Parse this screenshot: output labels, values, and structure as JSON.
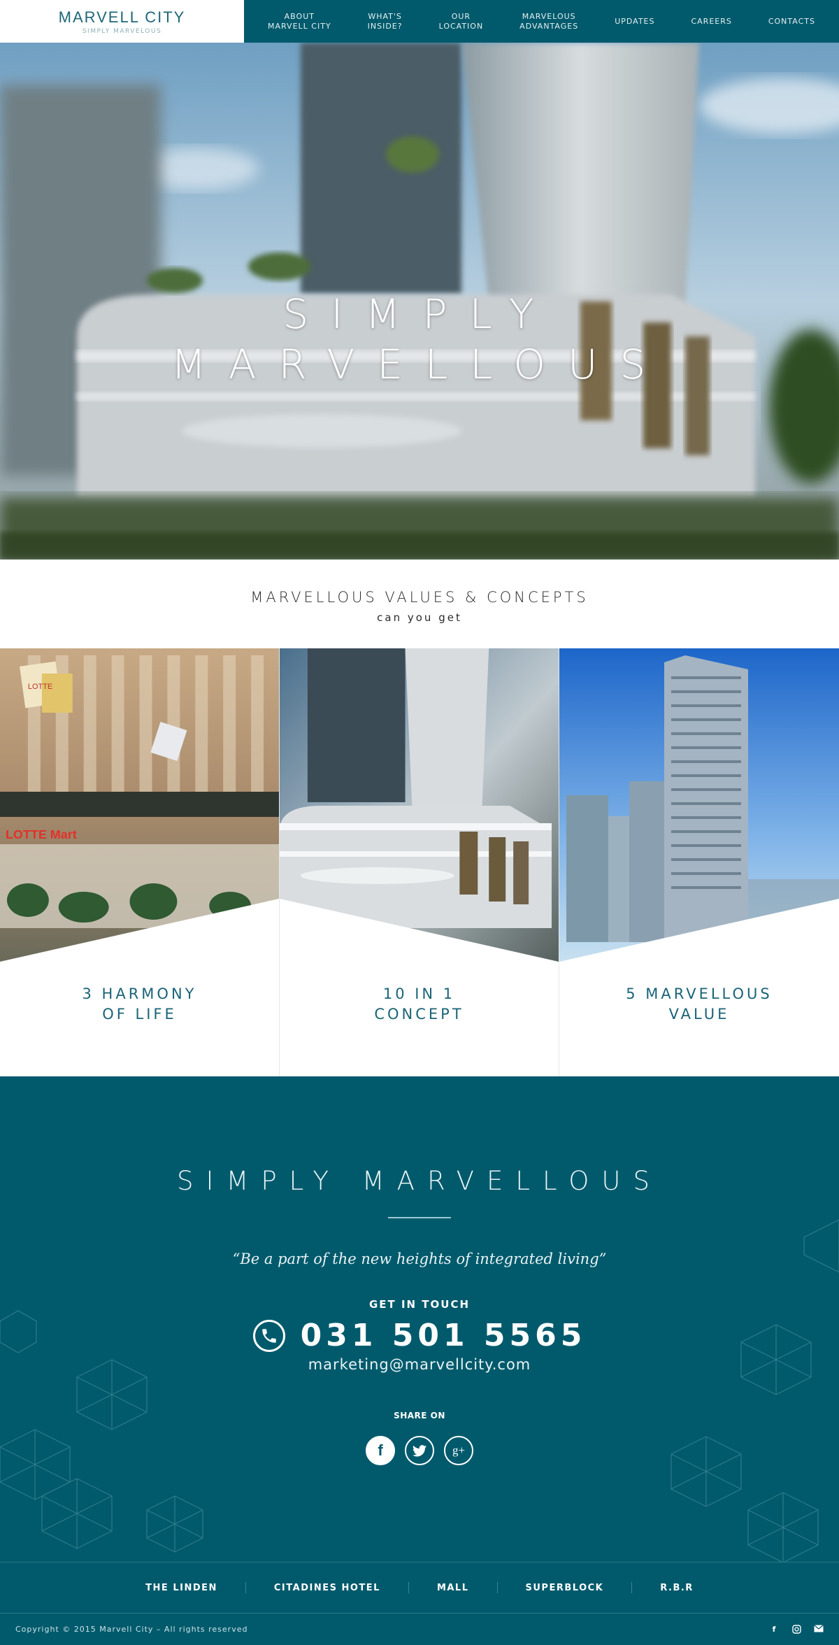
{
  "header": {
    "logo_text": "MARVELL CITY",
    "logo_tagline": "SIMPLY MARVELOUS",
    "nav": [
      {
        "label": "ABOUT\nMARVELL CITY"
      },
      {
        "label": "WHAT'S\nINSIDE?"
      },
      {
        "label": "OUR\nLOCATION"
      },
      {
        "label": "MARVELOUS\nADVANTAGES"
      },
      {
        "label": "UPDATES"
      },
      {
        "label": "CAREERS"
      },
      {
        "label": "CONTACTS"
      }
    ]
  },
  "hero": {
    "title": "SIMPLY\nMARVELLOUS",
    "scroll_icon": "chevron-down-icon",
    "social": [
      "facebook-icon",
      "instagram-icon",
      "mail-icon"
    ]
  },
  "values": {
    "title": "MARVELLOUS VALUES & CONCEPTS",
    "subtitle": "can you get",
    "cards": [
      {
        "label": "3 HARMONY\nOF LIFE"
      },
      {
        "label": "10 IN 1\nCONCEPT"
      },
      {
        "label": "5 MARVELLOUS\nVALUE"
      }
    ]
  },
  "contact": {
    "title": "SIMPLY MARVELLOUS",
    "quote": "“Be a part of the new heights of integrated living”",
    "get_in_touch": "GET IN TOUCH",
    "phone": "031 501 5565",
    "email": "marketing@marvellcity.com",
    "share_on": "SHARE ON",
    "share_buttons": [
      "facebook-icon",
      "twitter-icon",
      "google-plus-icon"
    ]
  },
  "footer": {
    "links": [
      {
        "label": "THE LINDEN"
      },
      {
        "label": "CITADINES HOTEL"
      },
      {
        "label": "MALL"
      },
      {
        "label": "SUPERBLOCK"
      },
      {
        "label": "R.B.R"
      }
    ],
    "copyright": "Copyright © 2015 Marvell City – All rights reserved"
  },
  "colors": {
    "brand_teal": "#005a6c",
    "accent_text": "#1a6477",
    "white": "#ffffff"
  }
}
